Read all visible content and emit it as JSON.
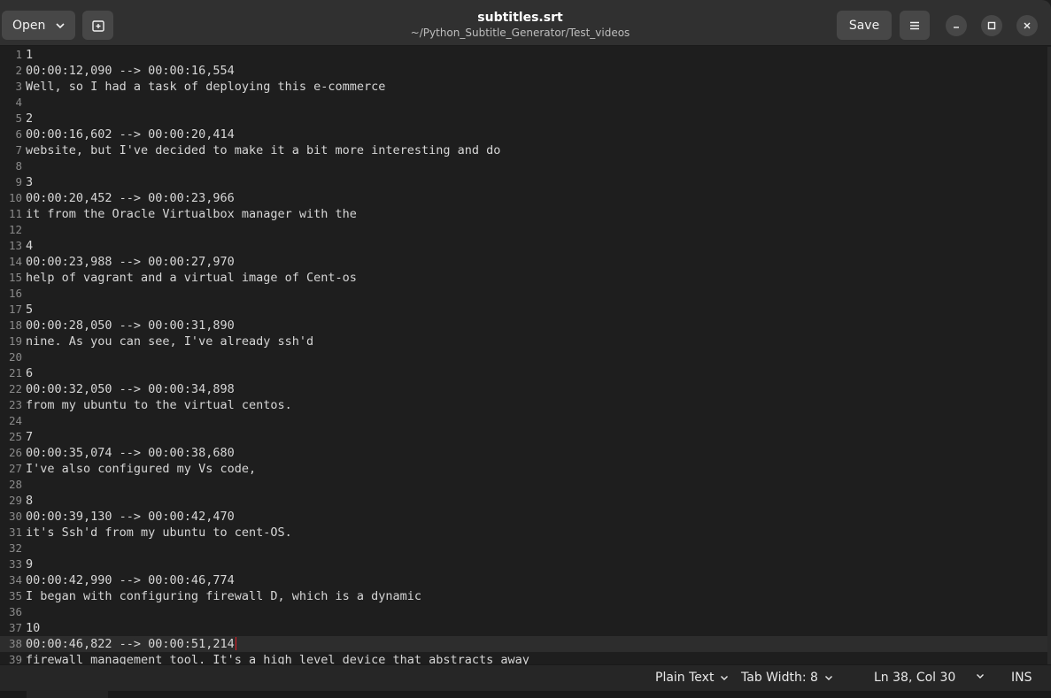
{
  "header": {
    "open_label": "Open",
    "save_label": "Save",
    "title": "subtitles.srt",
    "path": "~/Python_Subtitle_Generator/Test_videos"
  },
  "editor": {
    "current_line": 38,
    "lines": [
      {
        "n": "1",
        "text": "1"
      },
      {
        "n": "2",
        "text": "00:00:12,090 --> 00:00:16,554"
      },
      {
        "n": "3",
        "text": "Well, so I had a task of deploying this e-commerce"
      },
      {
        "n": "4",
        "text": ""
      },
      {
        "n": "5",
        "text": "2"
      },
      {
        "n": "6",
        "text": "00:00:16,602 --> 00:00:20,414"
      },
      {
        "n": "7",
        "text": "website, but I've decided to make it a bit more interesting and do"
      },
      {
        "n": "8",
        "text": ""
      },
      {
        "n": "9",
        "text": "3"
      },
      {
        "n": "10",
        "text": "00:00:20,452 --> 00:00:23,966"
      },
      {
        "n": "11",
        "text": "it from the Oracle Virtualbox manager with the"
      },
      {
        "n": "12",
        "text": ""
      },
      {
        "n": "13",
        "text": "4"
      },
      {
        "n": "14",
        "text": "00:00:23,988 --> 00:00:27,970"
      },
      {
        "n": "15",
        "text": "help of vagrant and a virtual image of Cent-os"
      },
      {
        "n": "16",
        "text": ""
      },
      {
        "n": "17",
        "text": "5"
      },
      {
        "n": "18",
        "text": "00:00:28,050 --> 00:00:31,890"
      },
      {
        "n": "19",
        "text": "nine. As you can see, I've already ssh'd"
      },
      {
        "n": "20",
        "text": ""
      },
      {
        "n": "21",
        "text": "6"
      },
      {
        "n": "22",
        "text": "00:00:32,050 --> 00:00:34,898"
      },
      {
        "n": "23",
        "text": "from my ubuntu to the virtual centos."
      },
      {
        "n": "24",
        "text": ""
      },
      {
        "n": "25",
        "text": "7"
      },
      {
        "n": "26",
        "text": "00:00:35,074 --> 00:00:38,680"
      },
      {
        "n": "27",
        "text": "I've also configured my Vs code,"
      },
      {
        "n": "28",
        "text": ""
      },
      {
        "n": "29",
        "text": "8"
      },
      {
        "n": "30",
        "text": "00:00:39,130 --> 00:00:42,470"
      },
      {
        "n": "31",
        "text": "it's Ssh'd from my ubuntu to cent-OS."
      },
      {
        "n": "32",
        "text": ""
      },
      {
        "n": "33",
        "text": "9"
      },
      {
        "n": "34",
        "text": "00:00:42,990 --> 00:00:46,774"
      },
      {
        "n": "35",
        "text": "I began with configuring firewall D, which is a dynamic"
      },
      {
        "n": "36",
        "text": ""
      },
      {
        "n": "37",
        "text": "10"
      },
      {
        "n": "38",
        "text": "00:00:46,822 --> 00:00:51,214"
      },
      {
        "n": "39",
        "text": "firewall management tool. It's a high level device that abstracts away"
      }
    ]
  },
  "statusbar": {
    "language": "Plain Text",
    "tab_width": "Tab Width: 8",
    "position": "Ln 38, Col 30",
    "mode": "INS"
  }
}
